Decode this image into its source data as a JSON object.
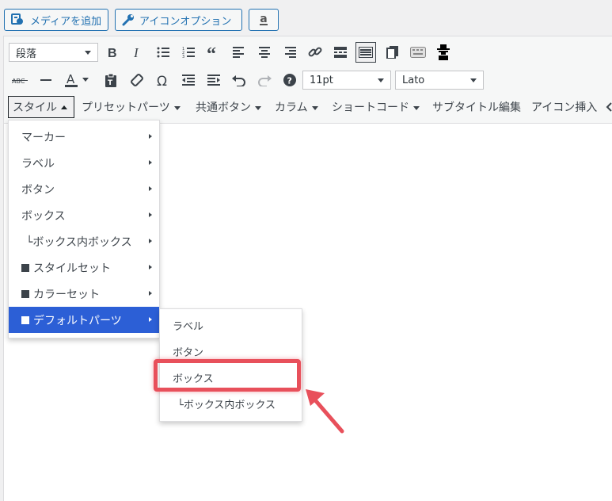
{
  "media_buttons": {
    "add_media": "メディアを追加",
    "icon_options": "アイコンオプション",
    "amazon": "a"
  },
  "toolbar_row1": {
    "format_select": "段落",
    "icons": [
      "bold-icon",
      "italic-icon",
      "bullet-list-icon",
      "numbered-list-icon",
      "blockquote-icon",
      "align-left-icon",
      "align-center-icon",
      "align-right-icon",
      "link-icon",
      "read-more-icon",
      "toolbar-toggle-icon",
      "copy-icon",
      "keyboard-icon",
      "spy-icon"
    ]
  },
  "toolbar_row2": {
    "strike_label": "ABC",
    "font_size": "11pt",
    "font_family": "Lato"
  },
  "menubar": {
    "items": [
      {
        "label": "スタイル"
      },
      {
        "label": "プリセットパーツ"
      },
      {
        "label": "共通ボタン"
      },
      {
        "label": "カラム"
      },
      {
        "label": "ショートコード"
      },
      {
        "label": "サブタイトル編集"
      },
      {
        "label": "アイコン挿入"
      }
    ]
  },
  "style_menu": {
    "items": [
      {
        "label": "マーカー"
      },
      {
        "label": "ラベル"
      },
      {
        "label": "ボタン"
      },
      {
        "label": "ボックス"
      },
      {
        "label": "└ボックス内ボックス"
      },
      {
        "label": "スタイルセット"
      },
      {
        "label": "カラーセット"
      },
      {
        "label": "デフォルトパーツ"
      }
    ]
  },
  "default_parts_submenu": {
    "items": [
      {
        "label": "ラベル"
      },
      {
        "label": "ボタン"
      },
      {
        "label": "ボックス"
      },
      {
        "label": "└ボックス内ボックス"
      }
    ]
  },
  "colors": {
    "highlight": "#2c5fd6",
    "callout": "#e8505b",
    "link_blue": "#2271b1"
  }
}
